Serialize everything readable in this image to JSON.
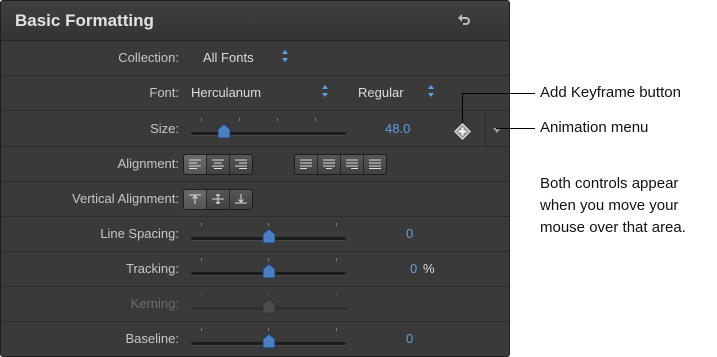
{
  "panel": {
    "title": "Basic Formatting",
    "rows": {
      "collection": {
        "label": "Collection:",
        "value": "All Fonts"
      },
      "font": {
        "label": "Font:",
        "family": "Herculanum",
        "style": "Regular"
      },
      "size": {
        "label": "Size:",
        "value": "48.0"
      },
      "alignment": {
        "label": "Alignment:"
      },
      "vertical_alignment": {
        "label": "Vertical Alignment:"
      },
      "line_spacing": {
        "label": "Line Spacing:",
        "value": "0"
      },
      "tracking": {
        "label": "Tracking:",
        "value": "0",
        "unit": "%"
      },
      "kerning": {
        "label": "Kerning:"
      },
      "baseline": {
        "label": "Baseline:",
        "value": "0"
      }
    }
  },
  "annotations": {
    "keyframe": "Add Keyframe button",
    "animation_menu": "Animation menu",
    "note_lines": [
      "Both controls appear",
      "when you move your",
      "mouse over that area."
    ]
  },
  "icons": {
    "reset": "reset-arrow-icon",
    "keyframe": "diamond-keyframe-icon",
    "animation_menu": "triangle-down-icon",
    "popup": "updown-arrows-icon"
  },
  "colors": {
    "panel_bg": "#3a3a3a",
    "value_blue": "#5f9ee8",
    "text_light": "#c7c7c7"
  }
}
